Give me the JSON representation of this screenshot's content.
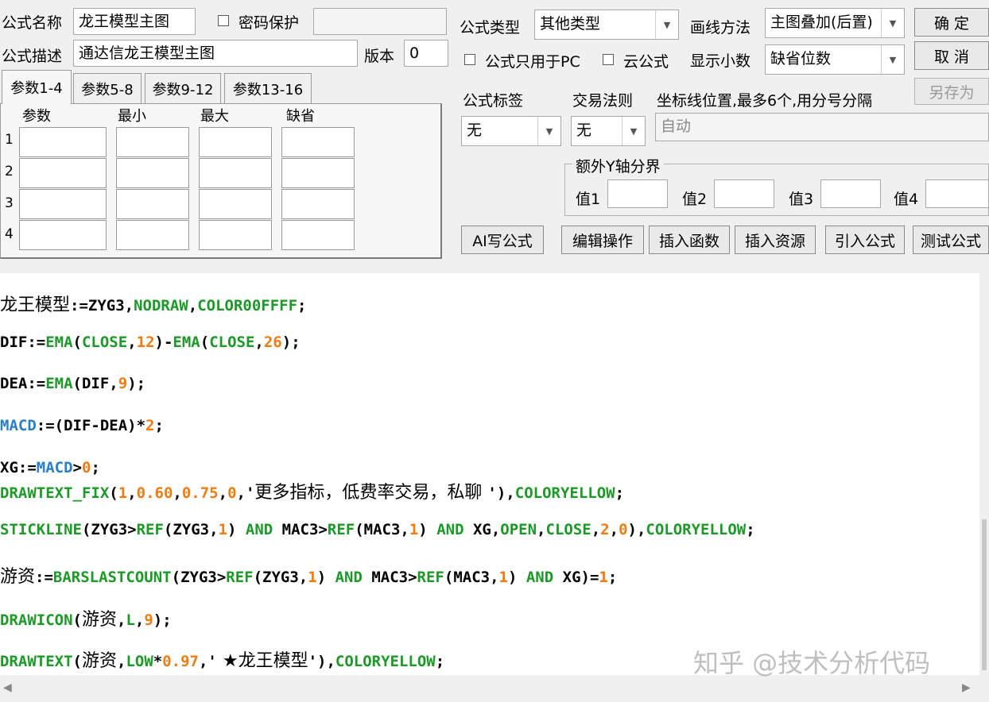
{
  "form": {
    "name_label": "公式名称",
    "name_value": "龙王模型主图",
    "password_label": "密码保护",
    "desc_label": "公式描述",
    "desc_value": "通达信龙王模型主图",
    "version_label": "版本",
    "version_value": "0",
    "type_label": "公式类型",
    "type_value": "其他类型",
    "draw_label": "画线方法",
    "draw_value": "主图叠加(后置)",
    "pc_only_label": "公式只用于PC",
    "cloud_label": "云公式",
    "decimals_label": "显示小数",
    "decimals_value": "缺省位数",
    "tag_label": "公式标签",
    "tag_value": "无",
    "trade_label": "交易法则",
    "trade_value": "无",
    "coord_label": "坐标线位置,最多6个,用分号分隔",
    "coord_value": "自动",
    "yaxis_group_label": "额外Y轴分界",
    "val1": "值1",
    "val2": "值2",
    "val3": "值3",
    "val4": "值4"
  },
  "buttons": {
    "ok": "确  定",
    "cancel": "取  消",
    "save_as": "另存为",
    "ai": "AI写公式",
    "edit": "编辑操作",
    "insert_fn": "插入函数",
    "insert_res": "插入资源",
    "import": "引入公式",
    "test": "测试公式"
  },
  "tabs": [
    "参数1-4",
    "参数5-8",
    "参数9-12",
    "参数13-16"
  ],
  "params": {
    "headers": [
      "参数",
      "最小",
      "最大",
      "缺省"
    ],
    "rows": [
      "1",
      "2",
      "3",
      "4"
    ]
  },
  "code_lines": [
    [
      [
        "cjk",
        "龙王模型"
      ],
      [
        "t",
        ":=ZYG3,"
      ],
      [
        "fn",
        "NODRAW"
      ],
      [
        "t",
        ","
      ],
      [
        "fn",
        "COLOR00FFFF"
      ],
      [
        "t",
        ";"
      ]
    ],
    [
      [
        "t",
        "DIF:="
      ],
      [
        "fn",
        "EMA"
      ],
      [
        "t",
        "("
      ],
      [
        "fn",
        "CLOSE"
      ],
      [
        "t",
        ","
      ],
      [
        "num",
        "12"
      ],
      [
        "t",
        ")-"
      ],
      [
        "fn",
        "EMA"
      ],
      [
        "t",
        "("
      ],
      [
        "fn",
        "CLOSE"
      ],
      [
        "t",
        ","
      ],
      [
        "num",
        "26"
      ],
      [
        "t",
        ");"
      ]
    ],
    [
      [
        "t",
        "DEA:="
      ],
      [
        "fn",
        "EMA"
      ],
      [
        "t",
        "(DIF,"
      ],
      [
        "num",
        "9"
      ],
      [
        "t",
        ");"
      ]
    ],
    [
      [
        "var",
        "MACD"
      ],
      [
        "t",
        ":=(DIF-DEA)*"
      ],
      [
        "num",
        "2"
      ],
      [
        "t",
        ";"
      ]
    ],
    [
      [
        "t",
        "XG:="
      ],
      [
        "var",
        "MACD"
      ],
      [
        "t",
        ">"
      ],
      [
        "num",
        "0"
      ],
      [
        "t",
        ";"
      ]
    ],
    [
      [
        "fn",
        "DRAWTEXT_FIX"
      ],
      [
        "t",
        "("
      ],
      [
        "num",
        "1"
      ],
      [
        "t",
        ","
      ],
      [
        "num",
        "0.60"
      ],
      [
        "t",
        ","
      ],
      [
        "num",
        "0.75"
      ],
      [
        "t",
        ","
      ],
      [
        "num",
        "0"
      ],
      [
        "t",
        ",'"
      ],
      [
        "str",
        "更多指标，低费率交易，私聊 "
      ],
      [
        "t",
        "'),"
      ],
      [
        "fn",
        "COLORYELLOW"
      ],
      [
        "t",
        ";"
      ]
    ],
    [
      [
        "fn",
        "STICKLINE"
      ],
      [
        "t",
        "(ZYG3>"
      ],
      [
        "fn",
        "REF"
      ],
      [
        "t",
        "(ZYG3,"
      ],
      [
        "num",
        "1"
      ],
      [
        "t",
        ") "
      ],
      [
        "fn",
        "AND"
      ],
      [
        "t",
        " MAC3>"
      ],
      [
        "fn",
        "REF"
      ],
      [
        "t",
        "(MAC3,"
      ],
      [
        "num",
        "1"
      ],
      [
        "t",
        ") "
      ],
      [
        "fn",
        "AND"
      ],
      [
        "t",
        " XG,"
      ],
      [
        "fn",
        "OPEN"
      ],
      [
        "t",
        ","
      ],
      [
        "fn",
        "CLOSE"
      ],
      [
        "t",
        ","
      ],
      [
        "num",
        "2"
      ],
      [
        "t",
        ","
      ],
      [
        "num",
        "0"
      ],
      [
        "t",
        "),"
      ],
      [
        "fn",
        "COLORYELLOW"
      ],
      [
        "t",
        ";"
      ]
    ],
    [
      [
        "cjk",
        "游资"
      ],
      [
        "t",
        ":="
      ],
      [
        "fn",
        "BARSLASTCOUNT"
      ],
      [
        "t",
        "(ZYG3>"
      ],
      [
        "fn",
        "REF"
      ],
      [
        "t",
        "(ZYG3,"
      ],
      [
        "num",
        "1"
      ],
      [
        "t",
        ") "
      ],
      [
        "fn",
        "AND"
      ],
      [
        "t",
        " MAC3>"
      ],
      [
        "fn",
        "REF"
      ],
      [
        "t",
        "(MAC3,"
      ],
      [
        "num",
        "1"
      ],
      [
        "t",
        ") "
      ],
      [
        "fn",
        "AND"
      ],
      [
        "t",
        " XG)="
      ],
      [
        "num",
        "1"
      ],
      [
        "t",
        ";"
      ]
    ],
    [
      [
        "fn",
        "DRAWICON"
      ],
      [
        "t",
        "("
      ],
      [
        "cjk",
        "游资"
      ],
      [
        "t",
        ","
      ],
      [
        "fn",
        "L"
      ],
      [
        "t",
        ","
      ],
      [
        "num",
        "9"
      ],
      [
        "t",
        ");"
      ]
    ],
    [
      [
        "fn",
        "DRAWTEXT"
      ],
      [
        "t",
        "("
      ],
      [
        "cjk",
        "游资"
      ],
      [
        "t",
        ","
      ],
      [
        "fn",
        "LOW"
      ],
      [
        "t",
        "*"
      ],
      [
        "num",
        "0.97"
      ],
      [
        "t",
        ",'"
      ],
      [
        "str",
        " ★龙王模型"
      ],
      [
        "t",
        "'),"
      ],
      [
        "fn",
        "COLORYELLOW"
      ],
      [
        "t",
        ";"
      ]
    ]
  ],
  "watermark": "知乎 @技术分析代码",
  "colors": {
    "function": "#1c9a28",
    "number": "#f07b10",
    "variable": "#2a7fc9"
  }
}
